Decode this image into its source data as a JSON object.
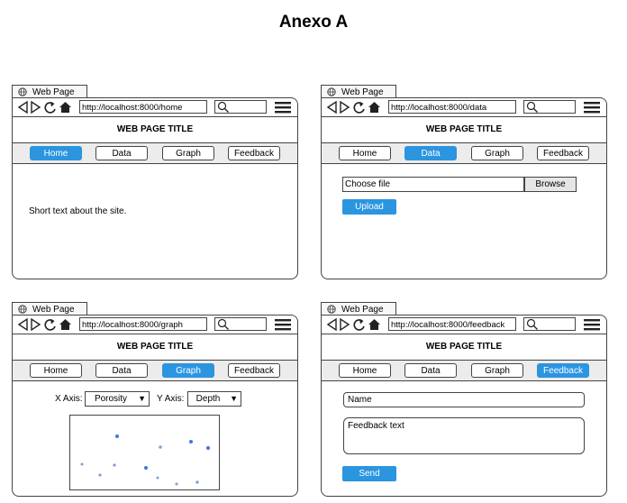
{
  "page": {
    "heading": "Anexo A"
  },
  "common": {
    "tab_label": "Web Page",
    "site_title": "WEB PAGE TITLE",
    "nav": [
      "Home",
      "Data",
      "Graph",
      "Feedback"
    ],
    "icons": [
      "globe-icon",
      "back-arrow-icon",
      "forward-arrow-icon",
      "reload-icon",
      "home-icon",
      "search-icon",
      "hamburger-menu-icon",
      "dropdown-arrow-icon"
    ],
    "accent_color": "#2b95e0"
  },
  "wireframes": {
    "home": {
      "url": "http://localhost:8000/home",
      "active_nav": "Home",
      "text": "Short text about the site."
    },
    "data": {
      "url": "http://localhost:8000/data",
      "active_nav": "Data",
      "file_placeholder": "Choose file",
      "browse_label": "Browse",
      "upload_label": "Upload"
    },
    "graph": {
      "url": "http://localhost:8000/graph",
      "active_nav": "Graph",
      "x_axis_label": "X Axis:",
      "x_axis_value": "Porosity",
      "y_axis_label": "Y Axis:",
      "y_axis_value": "Depth"
    },
    "feedback": {
      "url": "http://localhost:8000/feedback",
      "active_nav": "Feedback",
      "name_placeholder": "Name",
      "feedback_placeholder": "Feedback text",
      "send_label": "Send"
    }
  }
}
